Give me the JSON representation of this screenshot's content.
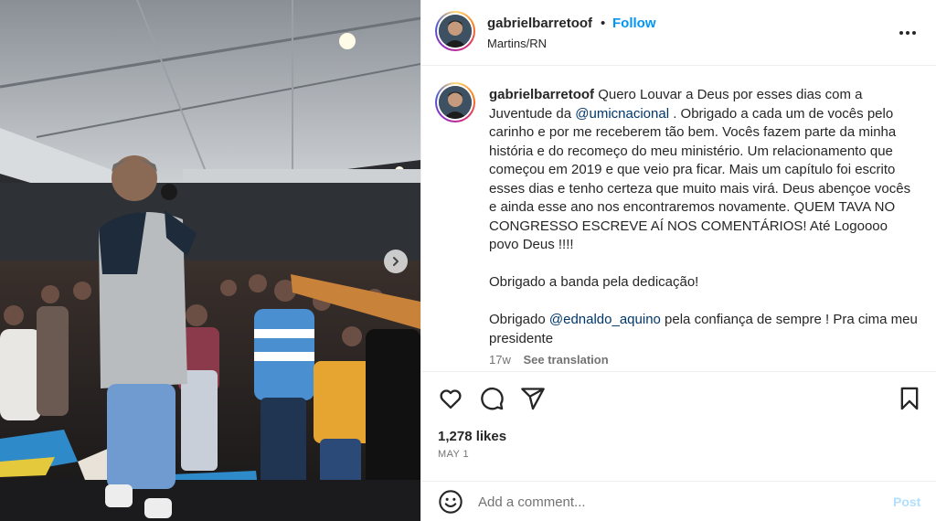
{
  "post": {
    "username": "gabrielbarretoof",
    "separator": "•",
    "follow_label": "Follow",
    "location": "Martins/RN",
    "caption": {
      "username": "gabrielbarretoof",
      "line1_text": " Quero Louvar a Deus por esses dias com a Juventude da ",
      "mention1": "@umicnacional",
      "line1_rest": " . Obrigado a cada um de vocês pelo carinho e por me receberem tão bem. Vocês fazem parte da minha história e do recomeço do meu ministério. Um relacionamento que começou em 2019 e que veio pra ficar. Mais um capítulo foi escrito esses dias e tenho certeza que muito mais virá. Deus abençoe vocês e ainda esse ano nos encontraremos novamente. QUEM TAVA NO CONGRESSO ESCREVE AÍ NOS COMENTÁRIOS! Até Logoooo povo Deus !!!!",
      "paragraph2": "Obrigado a banda pela dedicação!",
      "p3_prefix": "Obrigado ",
      "mention2": "@ednaldo_aquino",
      "p3_suffix": " pela confiança de sempre ! Pra cima meu presidente"
    },
    "age": "17w",
    "see_translation": "See translation",
    "likes": "1,278 likes",
    "date": "MAY 1"
  },
  "comment": {
    "placeholder": "Add a comment...",
    "post_label": "Post"
  },
  "icons": {
    "more": "more-options-icon",
    "like": "heart-icon",
    "comment": "comment-icon",
    "share": "share-icon",
    "save": "bookmark-icon",
    "emoji": "emoji-icon",
    "next": "chevron-right-icon"
  },
  "colors": {
    "follow": "#0095f6",
    "mention": "#00376b",
    "post_disabled": "#b2dffc",
    "secondary_text": "#737373"
  }
}
